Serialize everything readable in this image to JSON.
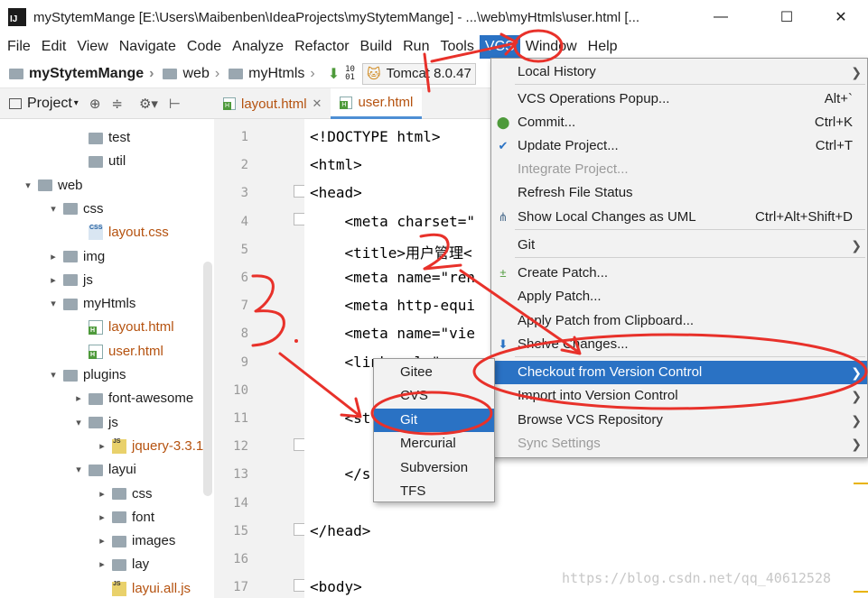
{
  "window": {
    "title": "myStytemMange [E:\\Users\\Maibenben\\IdeaProjects\\myStytemMange] - ...\\web\\myHtmls\\user.html [...",
    "minimize": "—",
    "maximize": "☐",
    "close": "✕"
  },
  "menubar": [
    "File",
    "Edit",
    "View",
    "Navigate",
    "Code",
    "Analyze",
    "Refactor",
    "Build",
    "Run",
    "Tools",
    "VCS",
    "Window",
    "Help"
  ],
  "breadcrumb": [
    "myStytemMange",
    "web",
    "myHtmls"
  ],
  "run_config": "Tomcat 8.0.47",
  "project_panel": {
    "label": "Project"
  },
  "tree": [
    {
      "label": "test",
      "kind": "folder",
      "depth": 3,
      "arrow": ""
    },
    {
      "label": "util",
      "kind": "folder",
      "depth": 3,
      "arrow": ""
    },
    {
      "label": "web",
      "kind": "folder",
      "depth": 1,
      "arrow": "▾"
    },
    {
      "label": "css",
      "kind": "folder",
      "depth": 2,
      "arrow": "▾"
    },
    {
      "label": "layout.css",
      "kind": "css",
      "depth": 3,
      "arrow": ""
    },
    {
      "label": "img",
      "kind": "folder",
      "depth": 2,
      "arrow": "▸"
    },
    {
      "label": "js",
      "kind": "folder",
      "depth": 2,
      "arrow": "▸"
    },
    {
      "label": "myHtmls",
      "kind": "folder",
      "depth": 2,
      "arrow": "▾"
    },
    {
      "label": "layout.html",
      "kind": "html",
      "depth": 3,
      "arrow": ""
    },
    {
      "label": "user.html",
      "kind": "html",
      "depth": 3,
      "arrow": ""
    },
    {
      "label": "plugins",
      "kind": "folder",
      "depth": 2,
      "arrow": "▾"
    },
    {
      "label": "font-awesome",
      "kind": "folder",
      "depth": 3,
      "arrow": "▸"
    },
    {
      "label": "js",
      "kind": "folder",
      "depth": 3,
      "arrow": "▾"
    },
    {
      "label": "jquery-3.3.1",
      "kind": "js",
      "depth": 4,
      "arrow": "▸"
    },
    {
      "label": "layui",
      "kind": "folder",
      "depth": 3,
      "arrow": "▾"
    },
    {
      "label": "css",
      "kind": "folder",
      "depth": 4,
      "arrow": "▸"
    },
    {
      "label": "font",
      "kind": "folder",
      "depth": 4,
      "arrow": "▸"
    },
    {
      "label": "images",
      "kind": "folder",
      "depth": 4,
      "arrow": "▸"
    },
    {
      "label": "lay",
      "kind": "folder",
      "depth": 4,
      "arrow": "▸"
    },
    {
      "label": "layui.all.js",
      "kind": "js",
      "depth": 4,
      "arrow": ""
    }
  ],
  "editor_tabs": [
    {
      "label": "layout.html",
      "active": false
    },
    {
      "label": "user.html",
      "active": true
    }
  ],
  "line_numbers": [
    "1",
    "2",
    "3",
    "4",
    "5",
    "6",
    "7",
    "8",
    "9",
    "10",
    "11",
    "12",
    "13",
    "14",
    "15",
    "16",
    "17"
  ],
  "code_lines": [
    "<!DOCTYPE html>",
    "<html>",
    "<head>",
    "    <meta charset=\"",
    "    <title>用户管理<",
    "    <meta name=\"ren",
    "    <meta http-equi",
    "    <meta name=\"vie",
    "    <link rel=\"",
    "",
    "    <st",
    "",
    "    </s",
    "",
    "</head>",
    "",
    "<body>"
  ],
  "vcs_menu": [
    {
      "label": "Local History",
      "shortcut": "",
      "submenu": true,
      "disabled": false,
      "icon": ""
    },
    {
      "label": "VCS Operations Popup...",
      "shortcut": "Alt+`",
      "submenu": false,
      "disabled": false,
      "icon": ""
    },
    {
      "label": "Commit...",
      "shortcut": "Ctrl+K",
      "submenu": false,
      "disabled": false,
      "icon": "commit-icon"
    },
    {
      "label": "Update Project...",
      "shortcut": "Ctrl+T",
      "submenu": false,
      "disabled": false,
      "icon": "update-icon"
    },
    {
      "label": "Integrate Project...",
      "shortcut": "",
      "submenu": false,
      "disabled": true,
      "icon": ""
    },
    {
      "label": "Refresh File Status",
      "shortcut": "",
      "submenu": false,
      "disabled": false,
      "icon": ""
    },
    {
      "label": "Show Local Changes as UML",
      "shortcut": "Ctrl+Alt+Shift+D",
      "submenu": false,
      "disabled": false,
      "icon": "uml-icon"
    },
    {
      "label": "Git",
      "shortcut": "",
      "submenu": true,
      "disabled": false,
      "icon": ""
    },
    {
      "label": "Create Patch...",
      "shortcut": "",
      "submenu": false,
      "disabled": false,
      "icon": "patch-icon"
    },
    {
      "label": "Apply Patch...",
      "shortcut": "",
      "submenu": false,
      "disabled": false,
      "icon": ""
    },
    {
      "label": "Apply Patch from Clipboard...",
      "shortcut": "",
      "submenu": false,
      "disabled": false,
      "icon": ""
    },
    {
      "label": "Shelve Changes...",
      "shortcut": "",
      "submenu": false,
      "disabled": false,
      "icon": "shelve-icon"
    },
    {
      "label": "Checkout from Version Control",
      "shortcut": "",
      "submenu": true,
      "disabled": false,
      "icon": ""
    },
    {
      "label": "Import into Version Control",
      "shortcut": "",
      "submenu": true,
      "disabled": false,
      "icon": ""
    },
    {
      "label": "Browse VCS Repository",
      "shortcut": "",
      "submenu": true,
      "disabled": false,
      "icon": ""
    },
    {
      "label": "Sync Settings",
      "shortcut": "",
      "submenu": true,
      "disabled": true,
      "icon": ""
    }
  ],
  "checkout_submenu": [
    "Gitee",
    "CVS",
    "Git",
    "Mercurial",
    "Subversion",
    "TFS"
  ],
  "annotations": [
    "1",
    "2",
    "3."
  ],
  "watermark": "https://blog.csdn.net/qq_40612528",
  "colors": {
    "menu_highlight": "#2a72c4",
    "annotation_red": "#e8312a",
    "menu_bg": "#f2f2f2"
  }
}
